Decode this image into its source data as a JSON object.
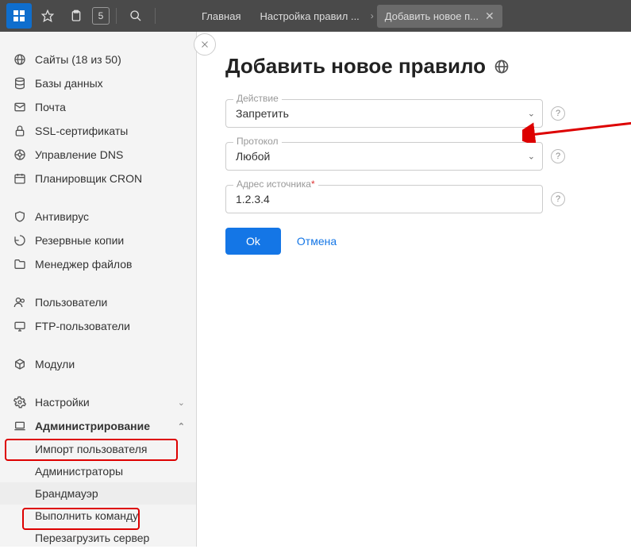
{
  "topbar": {
    "counter": "5"
  },
  "breadcrumbs": {
    "items": [
      "Главная",
      "Настройка правил ...",
      "Добавить новое п..."
    ]
  },
  "sidebar": {
    "items": [
      {
        "label": "Сайты (18 из 50)"
      },
      {
        "label": "Базы данных"
      },
      {
        "label": "Почта"
      },
      {
        "label": "SSL-сертификаты"
      },
      {
        "label": "Управление DNS"
      },
      {
        "label": "Планировщик CRON"
      }
    ],
    "group2": [
      {
        "label": "Антивирус"
      },
      {
        "label": "Резервные копии"
      },
      {
        "label": "Менеджер файлов"
      }
    ],
    "group3": [
      {
        "label": "Пользователи"
      },
      {
        "label": "FTP-пользователи"
      }
    ],
    "group4": [
      {
        "label": "Модули"
      }
    ],
    "group5": [
      {
        "label": "Настройки"
      },
      {
        "label": "Администрирование"
      }
    ],
    "subitems": [
      {
        "label": "Импорт пользователя"
      },
      {
        "label": "Администраторы"
      },
      {
        "label": "Брандмауэр"
      },
      {
        "label": "Выполнить команду"
      },
      {
        "label": "Перезагрузить сервер"
      }
    ]
  },
  "page": {
    "title": "Добавить новое правило"
  },
  "form": {
    "action": {
      "label": "Действие",
      "value": "Запретить"
    },
    "protocol": {
      "label": "Протокол",
      "value": "Любой"
    },
    "source": {
      "label": "Адрес источника",
      "value": "1.2.3.4",
      "required": "*"
    }
  },
  "buttons": {
    "ok": "Ok",
    "cancel": "Отмена"
  }
}
